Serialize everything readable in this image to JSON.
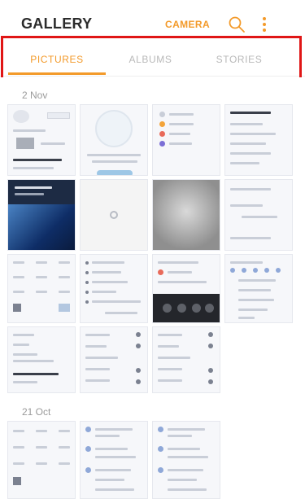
{
  "header": {
    "title": "GALLERY",
    "camera_label": "CAMERA",
    "search_icon": "search-icon",
    "more_icon": "more-vertical-icon",
    "accent_color": "#f39a2a"
  },
  "tabs": [
    {
      "label": "PICTURES",
      "active": true
    },
    {
      "label": "ALBUMS",
      "active": false
    },
    {
      "label": "STORIES",
      "active": false
    }
  ],
  "sections": [
    {
      "date": "2 Nov"
    },
    {
      "date": "21 Oct"
    }
  ]
}
